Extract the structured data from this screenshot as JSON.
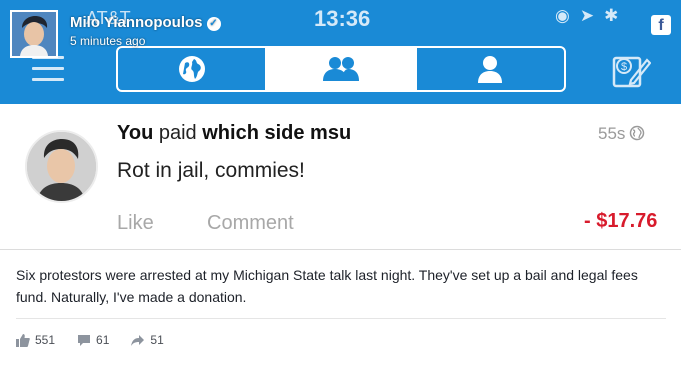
{
  "facebook_header": {
    "author": "Milo Yiannopoulos",
    "time": "5 minutes ago",
    "logo_letter": "f"
  },
  "phone_status": {
    "carrier": "AT&T",
    "clock": "13:36"
  },
  "venmo": {
    "tabs": [
      {
        "icon": "globe-icon",
        "active": false
      },
      {
        "icon": "friends-icon",
        "active": true
      },
      {
        "icon": "person-icon",
        "active": false
      }
    ],
    "transaction": {
      "payer": "You",
      "verb": "paid",
      "payee": "which side msu",
      "note": "Rot in jail, commies!",
      "elapsed": "55s",
      "like_label": "Like",
      "comment_label": "Comment",
      "amount": "- $17.76"
    }
  },
  "post": {
    "text": "Six protestors were arrested at my Michigan State talk last night. They've set up a bail and legal fees fund. Naturally, I've made a donation.",
    "likes": "551",
    "comments": "61",
    "shares": "51"
  },
  "colors": {
    "venmo_blue": "#1a8ad6",
    "amount_red": "#d81b2c",
    "facebook_blue": "#3b5998"
  }
}
